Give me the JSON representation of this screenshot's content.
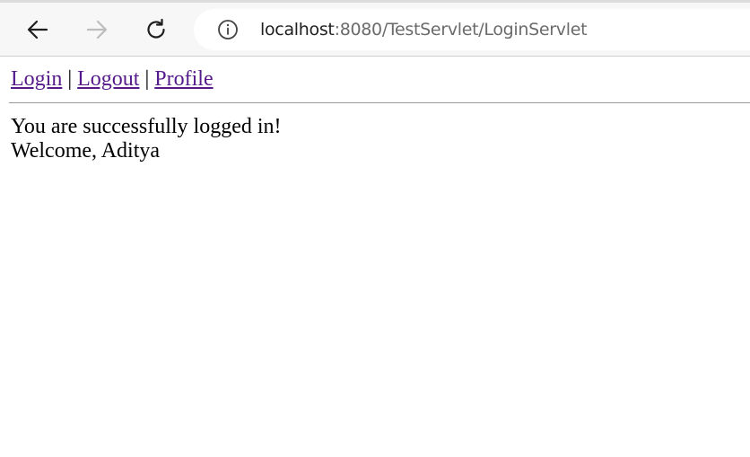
{
  "browser": {
    "url_host": "localhost",
    "url_rest": ":8080/TestServlet/LoginServlet",
    "back_icon": "arrow-left-icon",
    "forward_icon": "arrow-right-icon",
    "reload_icon": "reload-icon",
    "site_info_icon": "info-icon"
  },
  "nav": {
    "login": "Login",
    "separator1": " | ",
    "logout": "Logout",
    "separator2": " | ",
    "profile": "Profile"
  },
  "content": {
    "message": "You are successfully logged in!",
    "welcome": "Welcome, Aditya"
  },
  "colors": {
    "visited_link": "#551a8b",
    "chrome_bg": "#f7f7f7"
  }
}
